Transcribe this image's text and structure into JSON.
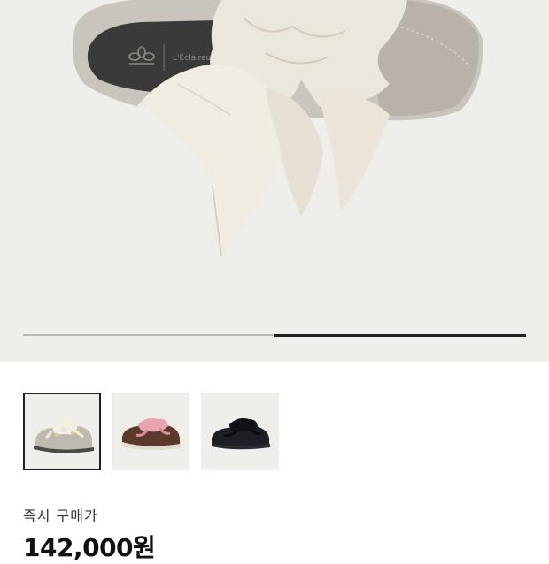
{
  "product": {
    "main_image": "sneaker-with-satin-ribbon-laces-ivory",
    "insole_text": "L'Éclaireur",
    "brand_icon": "adidas-trefoil-icon",
    "gallery_progress": 0.5
  },
  "thumbnails": [
    {
      "name": "ivory-satin-sneaker",
      "selected": true
    },
    {
      "name": "brown-pink-ribbon-sneaker",
      "selected": false
    },
    {
      "name": "black-ribbon-sneaker",
      "selected": false
    }
  ],
  "purchase": {
    "label": "즉시 구매가",
    "price": "142,000원"
  },
  "colors": {
    "hero_bg": "#efeeea",
    "progress_active": "#222222",
    "progress_inactive": "#b9b8b3"
  }
}
